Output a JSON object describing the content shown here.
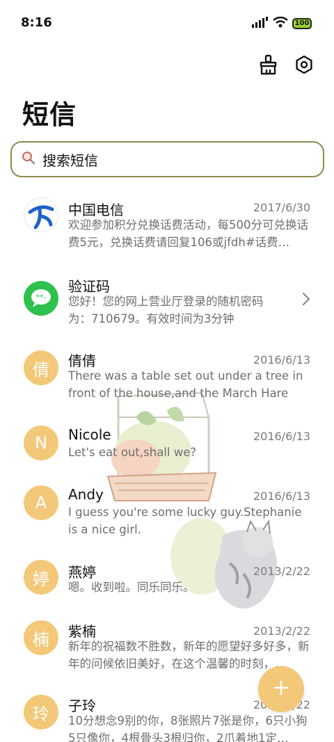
{
  "status_bar": {
    "time": "8:16",
    "battery": "100",
    "icons": [
      "signal-icon",
      "wifi-icon",
      "battery-icon"
    ]
  },
  "header": {
    "title": "短信",
    "actions": [
      "clean-brush-icon",
      "settings-icon"
    ]
  },
  "search": {
    "placeholder": "搜索短信"
  },
  "conversations": [
    {
      "name": "中国电信",
      "date": "2017/6/30",
      "preview": "欢迎参加积分兑换话费活动，每500分可兑换话费5元，兑换话费请回复106或jfdh#话费…",
      "avatar": "china-telecom-logo"
    },
    {
      "name": "验证码",
      "date": "",
      "preview": "您好！您的网上营业厅登录的随机密码为：710679。有效时间为3分钟",
      "avatar": "message-bubble-icon"
    },
    {
      "name": "倩倩",
      "date": "2016/6/13",
      "preview": "There was a table set out under a tree in front of the house,and the March Hare an…",
      "avatar_letter": "倩"
    },
    {
      "name": "Nicole",
      "date": "2016/6/13",
      "preview": "Let's eat out,shall we?",
      "avatar_letter": "N"
    },
    {
      "name": "Andy",
      "date": "2016/6/13",
      "preview": "I guess you're some lucky guy.Stephanie is a nice girl.",
      "avatar_letter": "A"
    },
    {
      "name": "燕婷",
      "date": "2013/2/22",
      "preview": "嗯。收到啦。同乐同乐。",
      "avatar_letter": "婷"
    },
    {
      "name": "紫楠",
      "date": "2013/2/22",
      "preview": "新年的祝福数不胜数，新年的愿望好多好多，新年的问候依旧美好，在这个温馨的时刻，…",
      "avatar_letter": "楠"
    },
    {
      "name": "子玲",
      "date": "2013/2/22",
      "preview": "10分想念9别的你，8张照片7张是你，6只小狗5只像你，4根骨头3根归你，2爪着地1定…",
      "avatar_letter": "玲"
    }
  ],
  "fab": {
    "icon": "plus-icon"
  },
  "colors": {
    "accent": "#f3c878",
    "search_border": "#8d8a4d",
    "telecom_blue": "#1b63c6",
    "message_green": "#2fc14d"
  }
}
